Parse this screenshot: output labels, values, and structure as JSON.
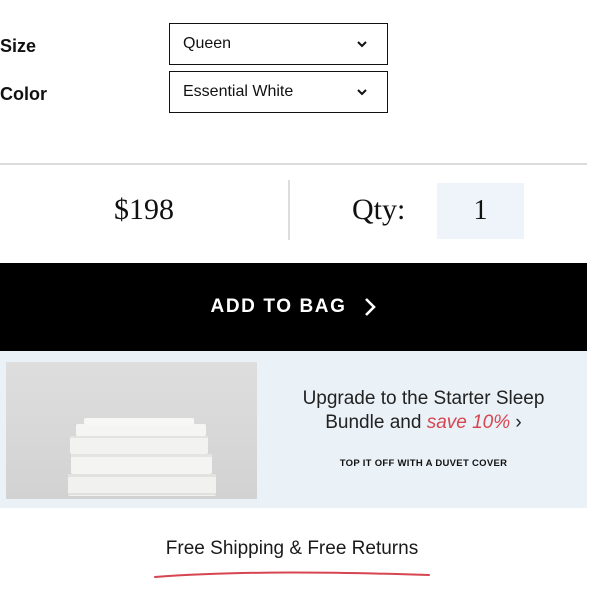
{
  "options": {
    "size": {
      "label": "Size",
      "value": "Queen"
    },
    "color": {
      "label": "Color",
      "value": "Essential White"
    }
  },
  "purchase": {
    "price": "$198",
    "qty_label": "Qty:",
    "qty_value": "1"
  },
  "cta": {
    "add_to_bag": "ADD TO BAG"
  },
  "promo": {
    "line1": "Upgrade to the Starter Sleep",
    "line2_prefix": "Bundle and",
    "line2_highlight": "save 10%",
    "chevron": "›",
    "subtext": "TOP IT OFF WITH A DUVET COVER",
    "accent_color": "#d64550"
  },
  "footer": {
    "shipping": "Free Shipping & Free Returns"
  },
  "colors": {
    "button_bg": "#000000",
    "promo_bg": "#eaf1f7",
    "qty_bg": "#eef4fa"
  },
  "icons": {
    "select": "chevron-down-icon",
    "cta": "chevron-right-icon"
  }
}
